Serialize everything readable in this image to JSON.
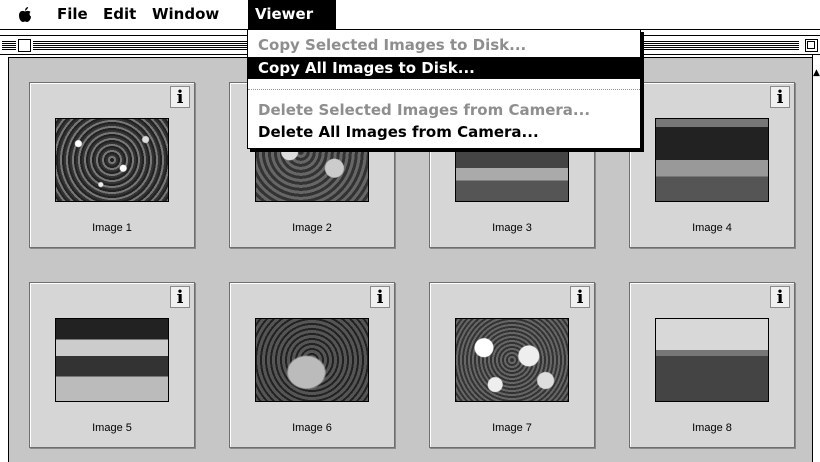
{
  "menubar": {
    "items": [
      "File",
      "Edit",
      "Window",
      "Viewer"
    ],
    "active": "Viewer"
  },
  "viewer_menu": {
    "items": [
      {
        "label": "Copy Selected Images to Disk...",
        "enabled": false
      },
      {
        "label": "Copy All Images to Disk...",
        "enabled": true,
        "highlighted": true
      },
      {
        "label": "Delete Selected Images from Camera...",
        "enabled": false
      },
      {
        "label": "Delete All Images from Camera...",
        "enabled": true
      }
    ]
  },
  "thumbnails": [
    {
      "label": "Image 1",
      "info": "i"
    },
    {
      "label": "Image 2",
      "info": "i"
    },
    {
      "label": "Image 3",
      "info": "i"
    },
    {
      "label": "Image 4",
      "info": "i"
    },
    {
      "label": "Image 5",
      "info": "i"
    },
    {
      "label": "Image 6",
      "info": "i"
    },
    {
      "label": "Image 7",
      "info": "i"
    },
    {
      "label": "Image 8",
      "info": "i"
    }
  ],
  "icons": {
    "apple": "apple-logo-icon",
    "info": "info-icon",
    "close": "close-box-icon",
    "zoom": "zoom-box-icon"
  },
  "colors": {
    "content_bg": "#c6c6c6",
    "highlight": "#000000",
    "disabled_text": "#8e8e8e"
  }
}
